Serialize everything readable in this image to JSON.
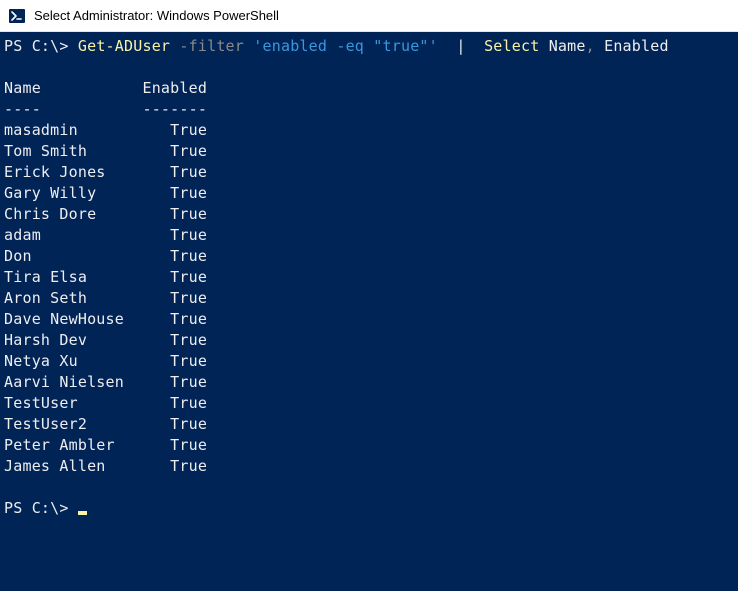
{
  "window": {
    "title": "Select Administrator: Windows PowerShell"
  },
  "prompt": "PS C:\\> ",
  "cmd": {
    "cmdlet": "Get-ADUser",
    "param_filter": "-filter",
    "filter_value": "'enabled -eq \"true\"'",
    "pipe": "|",
    "select": "Select",
    "col1": "Name",
    "comma": ",",
    "col2": "Enabled"
  },
  "headers": {
    "name": "Name",
    "enabled": "Enabled",
    "name_underline": "----",
    "enabled_underline": "-------"
  },
  "rows": [
    {
      "name": "masadmin",
      "enabled": "True"
    },
    {
      "name": "Tom Smith",
      "enabled": "True"
    },
    {
      "name": "Erick Jones",
      "enabled": "True"
    },
    {
      "name": "Gary Willy",
      "enabled": "True"
    },
    {
      "name": "Chris Dore",
      "enabled": "True"
    },
    {
      "name": "adam",
      "enabled": "True"
    },
    {
      "name": "Don",
      "enabled": "True"
    },
    {
      "name": "Tira Elsa",
      "enabled": "True"
    },
    {
      "name": "Aron Seth",
      "enabled": "True"
    },
    {
      "name": "Dave NewHouse",
      "enabled": "True"
    },
    {
      "name": "Harsh Dev",
      "enabled": "True"
    },
    {
      "name": "Netya Xu",
      "enabled": "True"
    },
    {
      "name": "Aarvi Nielsen",
      "enabled": "True"
    },
    {
      "name": "TestUser",
      "enabled": "True"
    },
    {
      "name": "TestUser2",
      "enabled": "True"
    },
    {
      "name": "Peter Ambler",
      "enabled": "True"
    },
    {
      "name": "James Allen",
      "enabled": "True"
    }
  ],
  "col_width_name": 14,
  "col_width_enabled": 7
}
